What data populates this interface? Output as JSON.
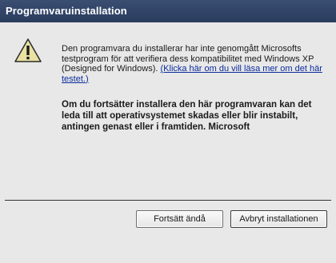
{
  "window": {
    "title": "Programvaruinstallation"
  },
  "message": {
    "body": "Den programvara du installerar har inte genomgått Microsofts testprogram för att verifiera dess kompatibilitet med Windows XP (Designed for Windows). ",
    "link": "(Klicka här om du vill läsa mer om det här testet.)",
    "warning": "Om du fortsätter installera den här programvaran kan det leda till att operativsystemet skadas eller blir instabilt, antingen genast eller i framtiden. Microsoft"
  },
  "buttons": {
    "continue": "Fortsätt ändå",
    "cancel": "Avbryt installationen"
  },
  "icons": {
    "warning": "warning-triangle-icon"
  },
  "colors": {
    "titlebar": "#2f4266",
    "link": "#0b2c9e",
    "background": "#e8e8e8"
  }
}
